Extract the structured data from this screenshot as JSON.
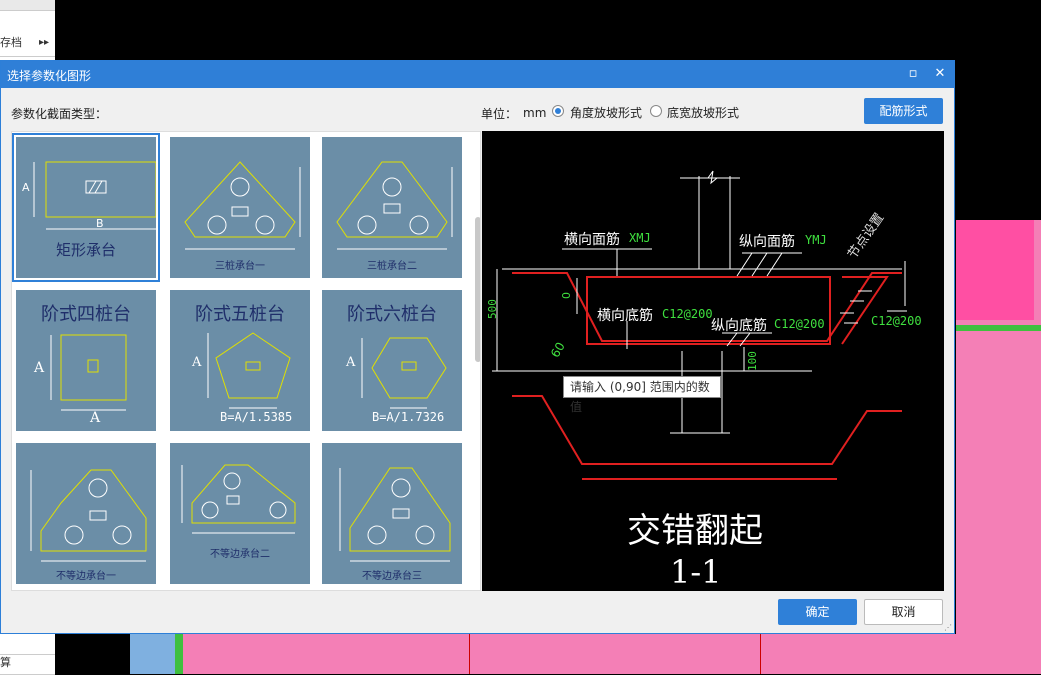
{
  "background": {
    "left_labels": [
      "存档",
      "算"
    ],
    "more_icon": "double-chevron-right"
  },
  "dialog": {
    "title": "选择参数化图形",
    "section_label": "参数化截面类型：",
    "unit_label": "单位：",
    "unit_value": "mm",
    "radio_angle": "角度放坡形式",
    "radio_width": "底宽放坡形式",
    "rebar_button": "配筋形式",
    "ok_button": "确定",
    "cancel_button": "取消"
  },
  "shapes": [
    {
      "caption": "矩形承台",
      "label_a": "A",
      "label_b": "B"
    },
    {
      "caption": "三桩承台一"
    },
    {
      "caption": "三桩承台二"
    },
    {
      "caption": "阶式四桩台",
      "label_a": "A",
      "label_b": "A"
    },
    {
      "caption": "阶式五桩台",
      "label_a": "A",
      "label_b": "B=A/1.5385"
    },
    {
      "caption": "阶式六桩台",
      "label_a": "A",
      "label_b": "B=A/1.7326"
    },
    {
      "caption": "不等边承台一"
    },
    {
      "caption": "不等边承台二"
    },
    {
      "caption": "不等边承台三"
    }
  ],
  "preview": {
    "label_xmj_cn": "横向面筋",
    "label_xmj_code": "XMJ",
    "label_ymj_cn": "纵向面筋",
    "label_ymj_code": "YMJ",
    "label_xdj_cn": "横向底筋",
    "label_xdj_code": "C12@200",
    "label_ydj_cn": "纵向底筋",
    "label_ydj_code": "C12@200",
    "label_side": "C12@200",
    "label_node": "节点设置",
    "dim_500": "500",
    "dim_0": "0",
    "dim_100": "100",
    "angle": "60",
    "title": "交错翻起",
    "section": "1-1",
    "tooltip": "请输入 (0,90] 范围内的数值"
  }
}
